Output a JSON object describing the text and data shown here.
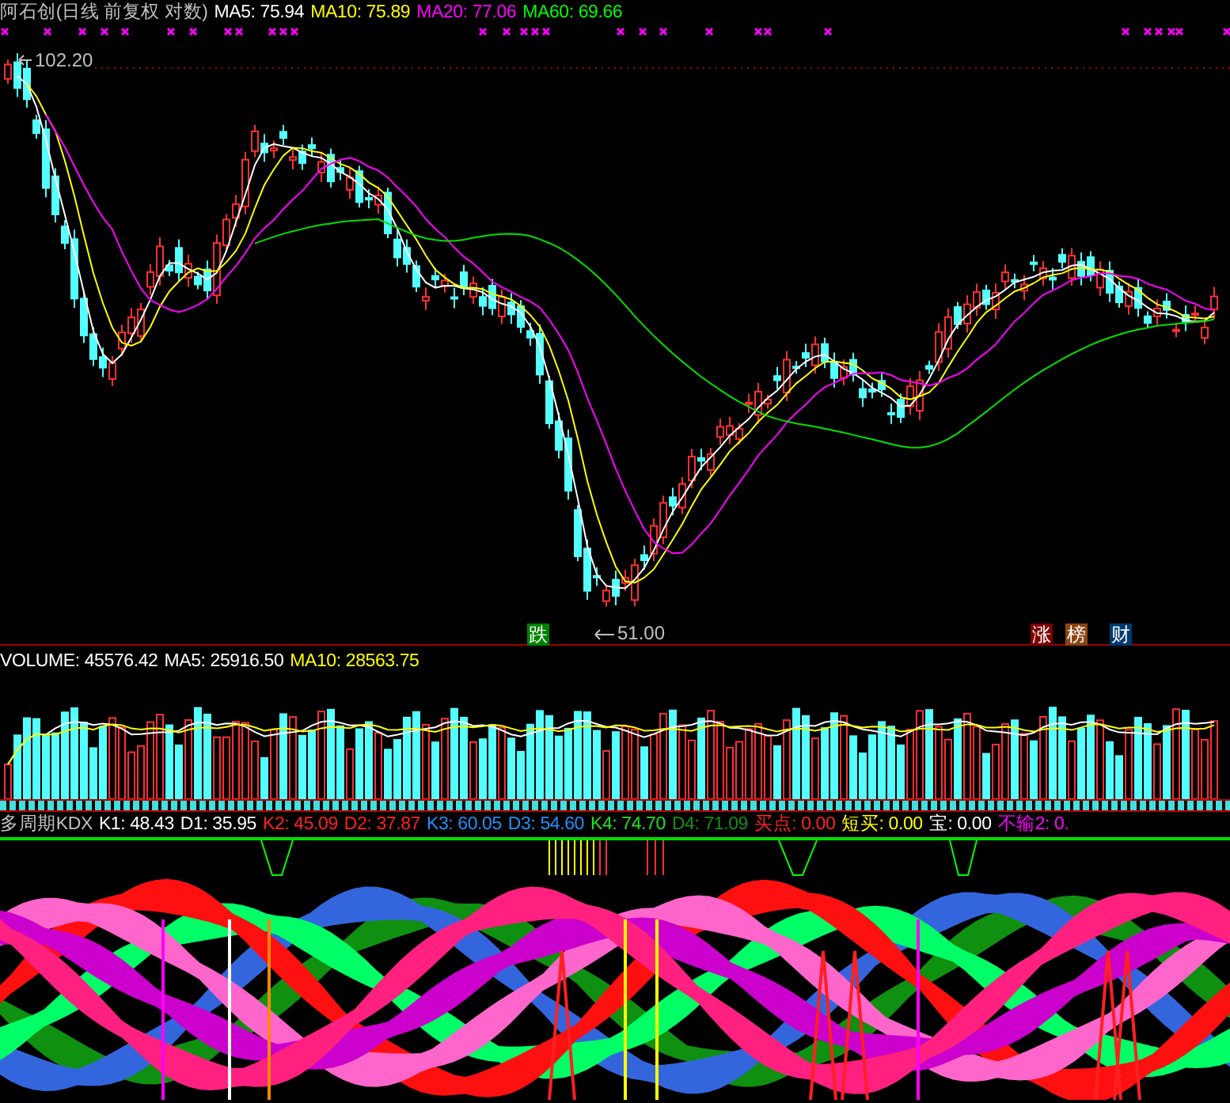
{
  "header": {
    "title": "阿石创(日线 前复权 对数)",
    "indicators": [
      {
        "label": "MA5: 75.94",
        "color": "#ffffff"
      },
      {
        "label": "MA10: 75.89",
        "color": "#ffff00"
      },
      {
        "label": "MA20: 77.06",
        "color": "#ff00ff"
      },
      {
        "label": "MA60: 69.66",
        "color": "#00ff00"
      }
    ]
  },
  "price_chart": {
    "high_label": "102.20",
    "low_label": "51.00",
    "badges": [
      {
        "text": "跌",
        "color": "#008000"
      },
      {
        "text": "涨",
        "color": "#800000"
      },
      {
        "text": "榜",
        "color": "#8b4513"
      },
      {
        "text": "财",
        "color": "#003a70"
      }
    ]
  },
  "volume": {
    "indicators": [
      {
        "label": "VOLUME: 45576.42",
        "color": "#ffffff"
      },
      {
        "label": "MA5: 25916.50",
        "color": "#ffffff"
      },
      {
        "label": "MA10: 28563.75",
        "color": "#ffff00"
      }
    ]
  },
  "kdx": {
    "indicators": [
      {
        "label": "多周期KDX",
        "color": "#c0c0c0"
      },
      {
        "label": "K1: 48.43",
        "color": "#ffffff"
      },
      {
        "label": "D1: 35.95",
        "color": "#ffffff"
      },
      {
        "label": "K2: 45.09",
        "color": "#ff2020"
      },
      {
        "label": "D2: 37.87",
        "color": "#ff2020"
      },
      {
        "label": "K3: 60.05",
        "color": "#2090ff"
      },
      {
        "label": "D3: 54.60",
        "color": "#2090ff"
      },
      {
        "label": "K4: 74.70",
        "color": "#20e020"
      },
      {
        "label": "D4: 71.09",
        "color": "#109010"
      },
      {
        "label": "买点: 0.00",
        "color": "#ff2020"
      },
      {
        "label": "短买: 0.00",
        "color": "#ffff00"
      },
      {
        "label": "宝: 0.00",
        "color": "#ffffff"
      },
      {
        "label": "不输2: 0.",
        "color": "#ff00ff"
      }
    ]
  }
}
